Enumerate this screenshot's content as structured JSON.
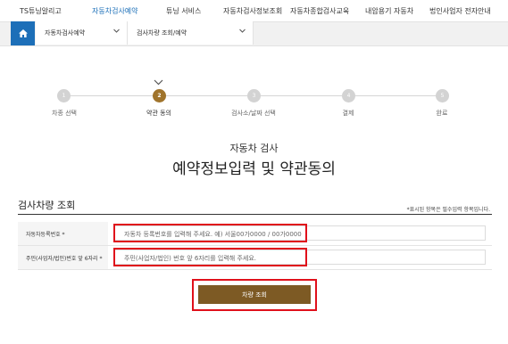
{
  "topnav": {
    "items": [
      {
        "label": "TS튜닝알리고",
        "active": false
      },
      {
        "label": "자동차검사예약",
        "active": true
      },
      {
        "label": "튜닝 서비스",
        "active": false
      },
      {
        "label": "자동차검사정보조회",
        "active": false
      },
      {
        "label": "자동차종합검사교육",
        "active": false
      },
      {
        "label": "내압용기 자동차",
        "active": false
      },
      {
        "label": "법인사업자 전자안내",
        "active": false
      }
    ]
  },
  "breadcrumb": {
    "level1": "자동차검사예약",
    "level2": "검사차량 조회/예약"
  },
  "stepper": {
    "current": 2,
    "steps": [
      {
        "number": "1",
        "label": "차종 선택"
      },
      {
        "number": "2",
        "label": "약관 동의"
      },
      {
        "number": "3",
        "label": "검사소/날짜 선택"
      },
      {
        "number": "4",
        "label": "결제"
      },
      {
        "number": "5",
        "label": "완료"
      }
    ]
  },
  "page": {
    "subtitle": "자동차 검사",
    "title": "예약정보입력 및 약관동의"
  },
  "section": {
    "title": "검사차량 조회",
    "required_note": "*표시된 항목은 필수입력 항목입니다."
  },
  "form": {
    "plate": {
      "label": "자동차등록번호 *",
      "placeholder": "자동차 등록번호를 입력해 주세요. 예) 서울00가0000 / 00가0000"
    },
    "idnum": {
      "label": "주민(사업자/법인)번호 앞 6자리 *",
      "placeholder": "주민(사업자/법인) 번호 앞 6자리를 입력해 주세요."
    }
  },
  "button": {
    "label": "차량 조회"
  },
  "colors": {
    "accent_blue": "#1d6fb8",
    "brown": "#7d5a24",
    "highlight": "#e0101b",
    "step_active": "#a0742c"
  }
}
